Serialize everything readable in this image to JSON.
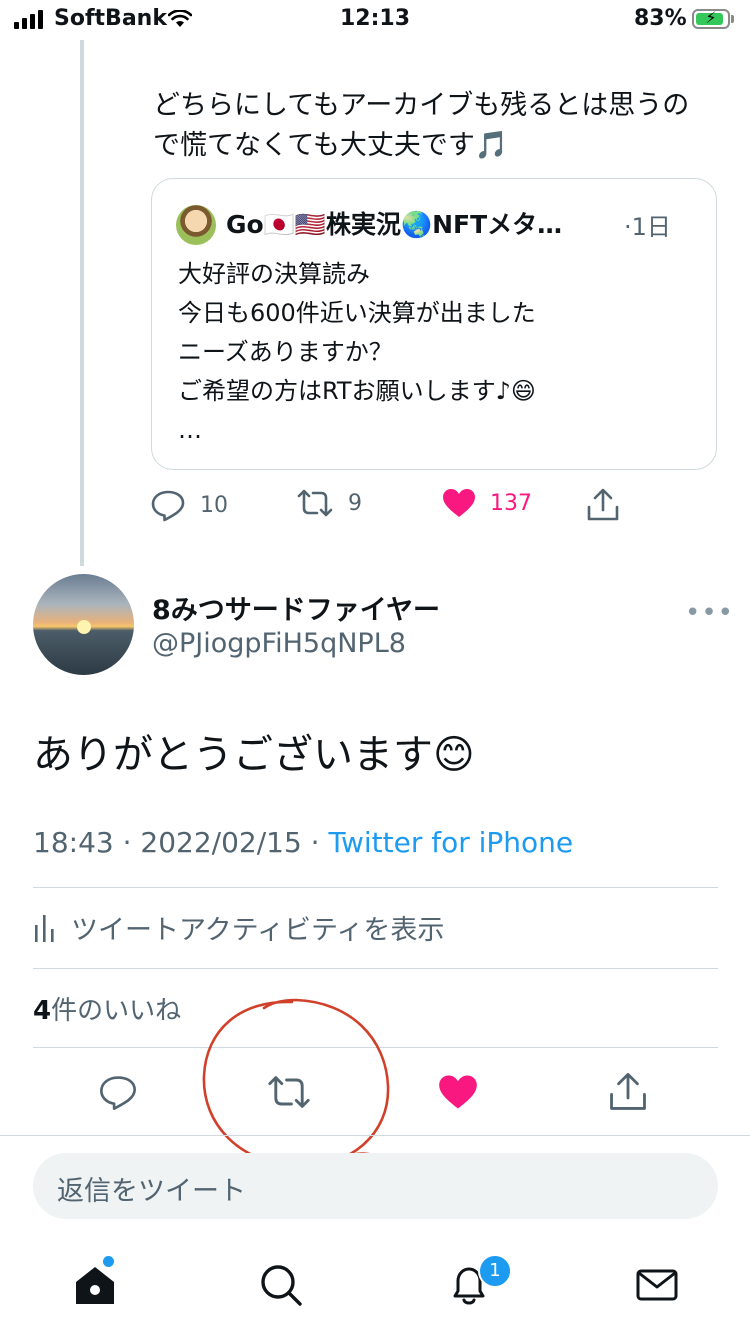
{
  "status_bar": {
    "carrier": "SoftBank",
    "time": "12:13",
    "battery_percent": "83%"
  },
  "parent_tweet": {
    "text_line1": "どちらにしてもアーカイブも残るとは思うの",
    "text_line2": "で慌てなくても大丈夫です🎵",
    "quote": {
      "name": "Go🇯🇵🇺🇸株実況🌏NFTメタ…",
      "date": "·1日",
      "lines": [
        "大好評の決算読み",
        "今日も600件近い決算が出ました",
        "ニーズありますか？",
        "ご希望の方はRTお願いします♪😄",
        "…"
      ]
    },
    "reply_count": "10",
    "retweet_count": "9",
    "like_count": "137"
  },
  "tweet": {
    "author_name": "8みつサードファイヤー",
    "author_handle": "@PJiogpFiH5qNPL8",
    "more_label": "•••",
    "body": "ありがとうございます😊",
    "timestamp": "18:43 · 2022/02/15 · ",
    "source": "Twitter for iPhone",
    "activity_label": "ツイートアクティビティを表示",
    "likes_count": "4",
    "likes_suffix": "件のいいね"
  },
  "reply_box": {
    "placeholder": "返信をツイート"
  },
  "tab_bar": {
    "notifications_badge": "1"
  },
  "colors": {
    "accent": "#1d9bf0",
    "like": "#f91880",
    "muted": "#536471",
    "annotation": "#d0402b"
  }
}
